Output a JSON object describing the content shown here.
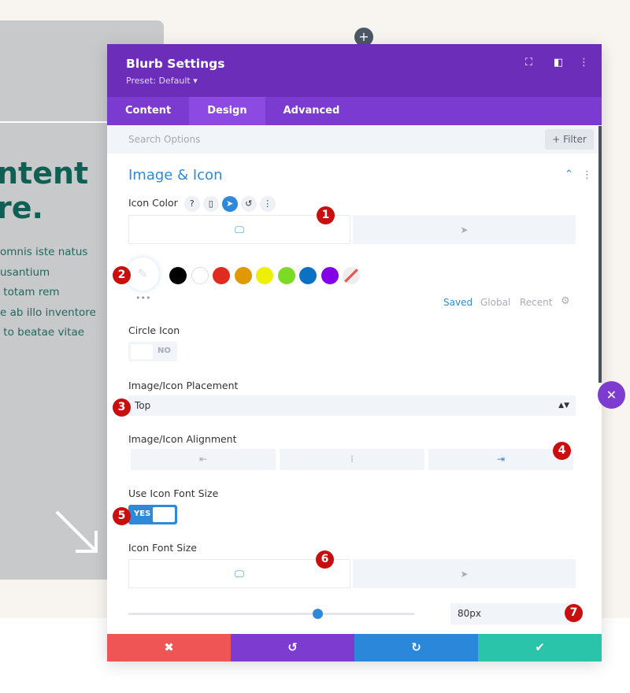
{
  "background_page": {
    "heading": "ntent\nre.",
    "body": "omnis iste natus\nusantium\n totam rem\ne ab illo inventore\n to beatae vitae"
  },
  "modal": {
    "title": "Blurb Settings",
    "preset": "Preset: Default ▾",
    "tabs": [
      {
        "label": "Content"
      },
      {
        "label": "Design",
        "active": true
      },
      {
        "label": "Advanced"
      }
    ],
    "search_placeholder": "Search Options",
    "filter_label": "+ Filter",
    "section_title": "Image & Icon",
    "icon_color": {
      "label": "Icon Color",
      "swatches": [
        "#000000",
        "#ffffff",
        "#e02b20",
        "#e09900",
        "#edf000",
        "#7cda24",
        "#0c71c3",
        "#8300e9"
      ],
      "palette_tabs": [
        "Saved",
        "Global",
        "Recent"
      ]
    },
    "circle_icon": {
      "label": "Circle Icon",
      "value": "NO"
    },
    "placement": {
      "label": "Image/Icon Placement",
      "value": "Top"
    },
    "alignment": {
      "label": "Image/Icon Alignment",
      "options": [
        "left",
        "center",
        "right"
      ],
      "selected": "right"
    },
    "use_font_size": {
      "label": "Use Icon Font Size",
      "value": "YES"
    },
    "font_size": {
      "label": "Icon Font Size",
      "value": "80px",
      "slider_percent": 66
    },
    "badges": [
      "1",
      "2",
      "3",
      "4",
      "5",
      "6",
      "7"
    ]
  },
  "colors": {
    "header": "#6c2eb9",
    "accent": "#2e8ad8",
    "cancel": "#ef5555",
    "undo": "#7e3bd0",
    "redo": "#2b87da",
    "save": "#29c4a9"
  }
}
